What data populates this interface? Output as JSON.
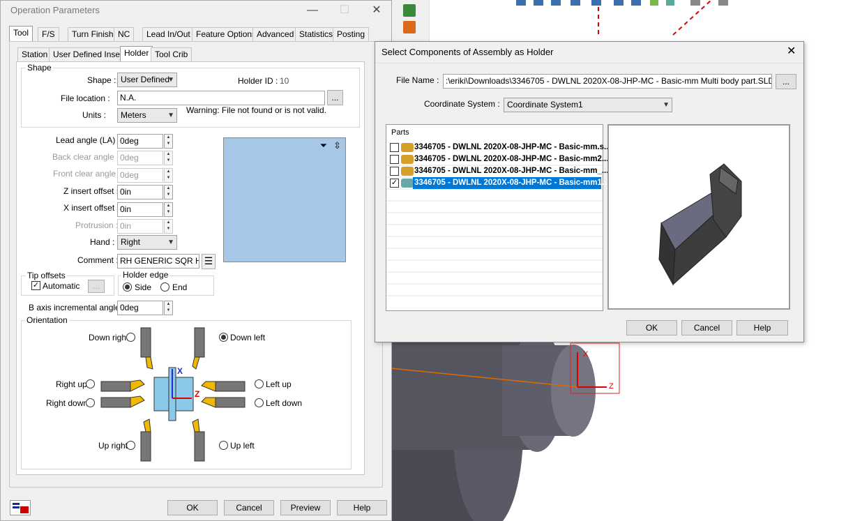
{
  "op_dialog": {
    "title": "Operation Parameters",
    "tabs": [
      "Tool",
      "F/S",
      "Turn Finish",
      "NC",
      "Lead In/Out",
      "Feature Options",
      "Advanced",
      "Statistics",
      "Posting"
    ],
    "subtabs": [
      "Station",
      "User Defined Insert",
      "Holder",
      "Tool Crib"
    ],
    "shape_group": "Shape",
    "shape_label": "Shape :",
    "shape_value": "User Defined",
    "holder_id_label": "Holder ID :",
    "holder_id_value": "10",
    "file_location_label": "File location :",
    "file_location_value": "N.A.",
    "browse": "...",
    "units_label": "Units :",
    "units_value": "Meters",
    "warning": "Warning: File not found or is not valid.",
    "lead_angle_label": "Lead angle (LA) :",
    "lead_angle_value": "0deg",
    "back_clear_label": "Back clear angle :",
    "back_clear_value": "0deg",
    "front_clear_label": "Front clear angle :",
    "front_clear_value": "0deg",
    "z_offset_label": "Z insert offset :",
    "z_offset_value": "0in",
    "x_offset_label": "X insert offset :",
    "x_offset_value": "0in",
    "protrusion_label": "Protrusion :",
    "protrusion_value": "0in",
    "hand_label": "Hand :",
    "hand_value": "Right",
    "comment_label": "Comment :",
    "comment_value": "RH GENERIC SQR HO",
    "tip_offsets_group": "Tip offsets",
    "automatic_label": "Automatic",
    "holder_edge_group": "Holder edge",
    "side_label": "Side",
    "end_label": "End",
    "b_axis_label": "B axis incremental angle :",
    "b_axis_value": "0deg",
    "orientation_group": "Orientation",
    "orient": {
      "down_right": "Down right",
      "down_left": "Down left",
      "right_up": "Right up",
      "right_down": "Right down",
      "left_up": "Left up",
      "left_down": "Left down",
      "up_right": "Up right",
      "up_left": "Up left",
      "x_axis": "X",
      "z_axis": "Z"
    },
    "buttons": {
      "ok": "OK",
      "cancel": "Cancel",
      "preview": "Preview",
      "help": "Help"
    }
  },
  "select_dialog": {
    "title": "Select Components of Assembly as Holder",
    "file_name_label": "File Name :",
    "file_name_value": ":\\eriki\\Downloads\\3346705 - DWLNL 2020X-08-JHP-MC - Basic-mm Multi body part.SLDASM",
    "browse": "...",
    "coord_label": "Coordinate System :",
    "coord_value": "Coordinate System1",
    "parts_label": "Parts",
    "parts": [
      {
        "name": "3346705 - DWLNL 2020X-08-JHP-MC - Basic-mm.s...",
        "checked": false
      },
      {
        "name": "3346705 - DWLNL 2020X-08-JHP-MC - Basic-mm2....",
        "checked": false
      },
      {
        "name": "3346705 - DWLNL 2020X-08-JHP-MC - Basic-mm_...",
        "checked": false
      },
      {
        "name": "3346705 - DWLNL 2020X-08-JHP-MC - Basic-mm1....",
        "checked": true
      }
    ],
    "buttons": {
      "ok": "OK",
      "cancel": "Cancel",
      "help": "Help"
    }
  },
  "cad": {
    "x_axis": "X",
    "z_axis": "Z"
  }
}
